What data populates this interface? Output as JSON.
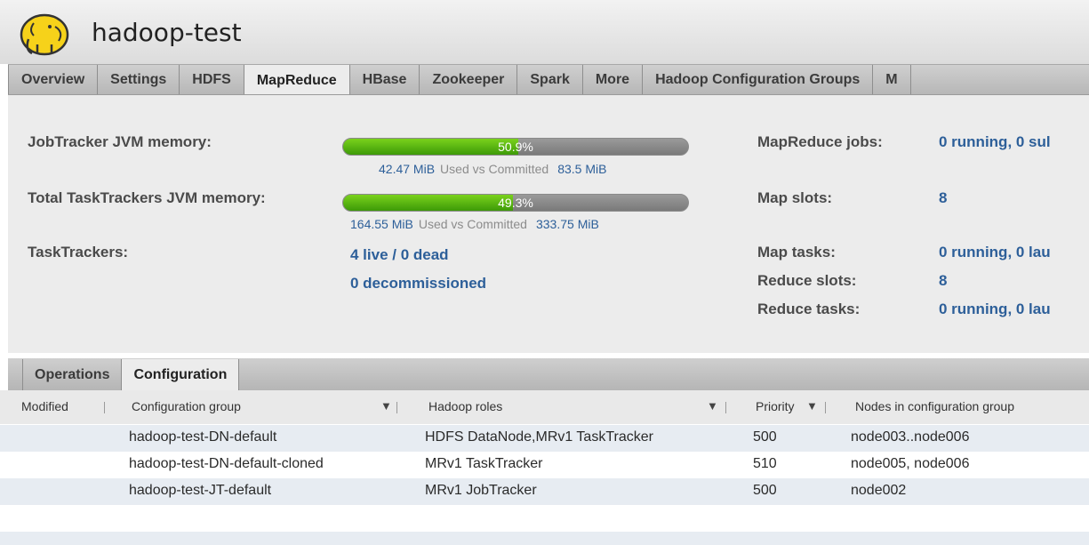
{
  "app": {
    "title": "hadoop-test",
    "logo_icon": "elephant-logo"
  },
  "main_tabs": [
    {
      "label": "Overview"
    },
    {
      "label": "Settings"
    },
    {
      "label": "HDFS"
    },
    {
      "label": "MapReduce",
      "active": true
    },
    {
      "label": "HBase"
    },
    {
      "label": "Zookeeper"
    },
    {
      "label": "Spark"
    },
    {
      "label": "More"
    },
    {
      "label": "Hadoop Configuration Groups"
    },
    {
      "label": "M"
    }
  ],
  "summary": {
    "jobtracker": {
      "label": "JobTracker JVM memory:",
      "percent": 50.9,
      "percent_text": "50.9%",
      "used": "42.47 MiB",
      "caption": "Used vs Committed",
      "committed": "83.5 MiB"
    },
    "tasktrackers_mem": {
      "label": "Total TaskTrackers JVM memory:",
      "percent": 49.3,
      "percent_text": "49.3%",
      "used": "164.55 MiB",
      "caption": "Used vs Committed",
      "committed": "333.75 MiB"
    },
    "tasktrackers": {
      "label": "TaskTrackers:",
      "live": "4 live / 0 dead",
      "decommissioned": "0 decommissioned"
    },
    "right": {
      "jobs_label": "MapReduce jobs:",
      "jobs_value": "0 running, 0 sul",
      "map_slots_label": "Map slots:",
      "map_slots_value": "8",
      "map_tasks_label": "Map tasks:",
      "map_tasks_value": "0 running, 0 lau",
      "reduce_slots_label": "Reduce slots:",
      "reduce_slots_value": "8",
      "reduce_tasks_label": "Reduce tasks:",
      "reduce_tasks_value": "0 running, 0 lau"
    }
  },
  "sub_tabs": [
    {
      "label": "Operations"
    },
    {
      "label": "Configuration",
      "active": true
    }
  ],
  "table": {
    "headers": {
      "modified": "Modified",
      "group": "Configuration group",
      "roles": "Hadoop roles",
      "priority": "Priority",
      "nodes": "Nodes in configuration group",
      "sort_arrow": "▼"
    },
    "rows": [
      {
        "group": "hadoop-test-DN-default",
        "roles": "HDFS DataNode,MRv1 TaskTracker",
        "priority": "500",
        "nodes": "node003..node006"
      },
      {
        "group": "hadoop-test-DN-default-cloned",
        "roles": "MRv1 TaskTracker",
        "priority": "510",
        "nodes": "node005, node006"
      },
      {
        "group": "hadoop-test-JT-default",
        "roles": "MRv1 JobTracker",
        "priority": "500",
        "nodes": "node002"
      }
    ]
  }
}
